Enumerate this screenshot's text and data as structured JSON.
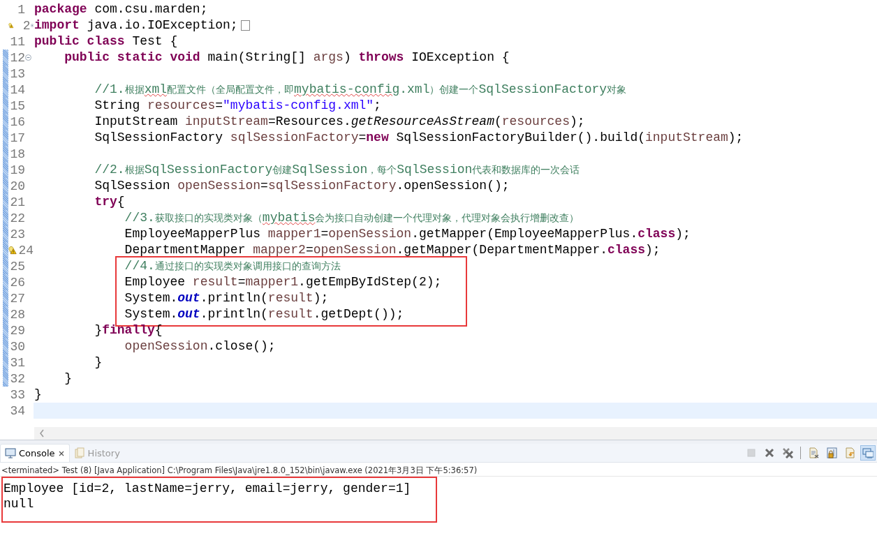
{
  "editor": {
    "lines": [
      {
        "number": "1",
        "tokens": [
          {
            "kind": "kw",
            "t": "package "
          },
          {
            "kind": "txt",
            "t": "com.csu.marden;"
          }
        ]
      },
      {
        "number": "2",
        "warning": true,
        "expanded": false,
        "folded": true,
        "tokens": [
          {
            "kind": "kw",
            "t": "import "
          },
          {
            "kind": "txt",
            "t": "java.io.IOException;"
          }
        ]
      },
      {
        "number": "11",
        "tokens": [
          {
            "kind": "kw",
            "t": "public class "
          },
          {
            "kind": "txt",
            "t": "Test {"
          }
        ]
      },
      {
        "number": "12",
        "changed": true,
        "expanded": true,
        "tokens": [
          {
            "kind": "kw",
            "t": "    public static void "
          },
          {
            "kind": "txt",
            "t": "main(String[] "
          },
          {
            "kind": "var",
            "t": "args"
          },
          {
            "kind": "txt",
            "t": ") "
          },
          {
            "kind": "kw",
            "t": "throws "
          },
          {
            "kind": "txt",
            "t": "IOException {"
          }
        ]
      },
      {
        "number": "13",
        "changed": true
      },
      {
        "number": "14",
        "changed": true,
        "tokens": [
          {
            "kind": "cmt",
            "t": "        //1."
          },
          {
            "kind": "cjk",
            "t": "根据"
          },
          {
            "kind": "err",
            "t": "xml"
          },
          {
            "kind": "cjk",
            "t": "配置文件（全局配置文件，即"
          },
          {
            "kind": "err",
            "t": "mybatis-config"
          },
          {
            "kind": "cmt",
            "t": ".xml"
          },
          {
            "kind": "cjk",
            "t": "）创建一个"
          },
          {
            "kind": "cmt",
            "t": "SqlSessionFactory"
          },
          {
            "kind": "cjk",
            "t": "对象"
          }
        ]
      },
      {
        "number": "15",
        "changed": true,
        "tokens": [
          {
            "kind": "txt",
            "t": "        String "
          },
          {
            "kind": "var",
            "t": "resources"
          },
          {
            "kind": "txt",
            "t": "="
          },
          {
            "kind": "str",
            "t": "\"mybatis-config.xml\""
          },
          {
            "kind": "txt",
            "t": ";"
          }
        ]
      },
      {
        "number": "16",
        "changed": true,
        "tokens": [
          {
            "kind": "txt",
            "t": "        InputStream "
          },
          {
            "kind": "var",
            "t": "inputStream"
          },
          {
            "kind": "txt",
            "t": "=Resources."
          },
          {
            "kind": "ital",
            "t": "getResourceAsStream"
          },
          {
            "kind": "txt",
            "t": "("
          },
          {
            "kind": "var",
            "t": "resources"
          },
          {
            "kind": "txt",
            "t": ");"
          }
        ]
      },
      {
        "number": "17",
        "changed": true,
        "tokens": [
          {
            "kind": "txt",
            "t": "        SqlSessionFactory "
          },
          {
            "kind": "var",
            "t": "sqlSessionFactory"
          },
          {
            "kind": "txt",
            "t": "="
          },
          {
            "kind": "kw",
            "t": "new"
          },
          {
            "kind": "txt",
            "t": " SqlSessionFactoryBuilder().build("
          },
          {
            "kind": "var",
            "t": "inputStream"
          },
          {
            "kind": "txt",
            "t": ");"
          }
        ]
      },
      {
        "number": "18",
        "changed": true
      },
      {
        "number": "19",
        "changed": true,
        "tokens": [
          {
            "kind": "cmt",
            "t": "        //2."
          },
          {
            "kind": "cjk",
            "t": "根据"
          },
          {
            "kind": "cmt",
            "t": "SqlSessionFactory"
          },
          {
            "kind": "cjk",
            "t": "创建"
          },
          {
            "kind": "cmt",
            "t": "SqlSession"
          },
          {
            "kind": "cjk",
            "t": "，每个"
          },
          {
            "kind": "cmt",
            "t": "SqlSession"
          },
          {
            "kind": "cjk",
            "t": "代表和数据库的一次会话"
          }
        ]
      },
      {
        "number": "20",
        "changed": true,
        "tokens": [
          {
            "kind": "txt",
            "t": "        SqlSession "
          },
          {
            "kind": "var",
            "t": "openSession"
          },
          {
            "kind": "txt",
            "t": "="
          },
          {
            "kind": "var",
            "t": "sqlSessionFactory"
          },
          {
            "kind": "txt",
            "t": ".openSession();"
          }
        ]
      },
      {
        "number": "21",
        "changed": true,
        "tokens": [
          {
            "kind": "kw",
            "t": "        try"
          },
          {
            "kind": "txt",
            "t": "{"
          }
        ]
      },
      {
        "number": "22",
        "changed": true,
        "tokens": [
          {
            "kind": "cmt",
            "t": "            //3."
          },
          {
            "kind": "cjk",
            "t": "获取接口的实现类对象（"
          },
          {
            "kind": "err",
            "t": "mybatis"
          },
          {
            "kind": "cjk",
            "t": "会为接口自动创建一个代理对象，代理对象会执行增删改查）"
          }
        ]
      },
      {
        "number": "23",
        "changed": true,
        "tokens": [
          {
            "kind": "txt",
            "t": "            EmployeeMapperPlus "
          },
          {
            "kind": "var",
            "t": "mapper1"
          },
          {
            "kind": "txt",
            "t": "="
          },
          {
            "kind": "var",
            "t": "openSession"
          },
          {
            "kind": "txt",
            "t": ".getMapper(EmployeeMapperPlus."
          },
          {
            "kind": "kw",
            "t": "class"
          },
          {
            "kind": "txt",
            "t": ");"
          }
        ]
      },
      {
        "number": "24",
        "changed": true,
        "warning": true,
        "tokens": [
          {
            "kind": "txt",
            "t": "            DepartmentMapper "
          },
          {
            "kind": "var",
            "t": "mapper2"
          },
          {
            "kind": "txt",
            "t": "="
          },
          {
            "kind": "var",
            "t": "openSession"
          },
          {
            "kind": "txt",
            "t": ".getMapper(DepartmentMapper."
          },
          {
            "kind": "kw",
            "t": "class"
          },
          {
            "kind": "txt",
            "t": ");"
          }
        ]
      },
      {
        "number": "25",
        "changed": true,
        "boxed": true,
        "tokens": [
          {
            "kind": "cmt",
            "t": "            //4."
          },
          {
            "kind": "cjk",
            "t": "通过接口的实现类对象调用接口的查询方法"
          }
        ]
      },
      {
        "number": "26",
        "changed": true,
        "boxed": true,
        "tokens": [
          {
            "kind": "txt",
            "t": "            Employee "
          },
          {
            "kind": "var",
            "t": "result"
          },
          {
            "kind": "txt",
            "t": "="
          },
          {
            "kind": "var",
            "t": "mapper1"
          },
          {
            "kind": "txt",
            "t": ".getEmpByIdStep(2);"
          }
        ]
      },
      {
        "number": "27",
        "changed": true,
        "boxed": true,
        "tokens": [
          {
            "kind": "txt",
            "t": "            System."
          },
          {
            "kind": "field",
            "t": "out"
          },
          {
            "kind": "txt",
            "t": ".println("
          },
          {
            "kind": "var",
            "t": "result"
          },
          {
            "kind": "txt",
            "t": ");"
          }
        ]
      },
      {
        "number": "28",
        "changed": true,
        "boxed": true,
        "tokens": [
          {
            "kind": "txt",
            "t": "            System."
          },
          {
            "kind": "field",
            "t": "out"
          },
          {
            "kind": "txt",
            "t": ".println("
          },
          {
            "kind": "var",
            "t": "result"
          },
          {
            "kind": "txt",
            "t": ".getDept());"
          }
        ]
      },
      {
        "number": "29",
        "changed": true,
        "tokens": [
          {
            "kind": "txt",
            "t": "        }"
          },
          {
            "kind": "kw",
            "t": "finally"
          },
          {
            "kind": "txt",
            "t": "{"
          }
        ]
      },
      {
        "number": "30",
        "changed": true,
        "tokens": [
          {
            "kind": "var",
            "t": "            openSession"
          },
          {
            "kind": "txt",
            "t": ".close();"
          }
        ]
      },
      {
        "number": "31",
        "changed": true,
        "tokens": [
          {
            "kind": "txt",
            "t": "        }"
          }
        ]
      },
      {
        "number": "32",
        "changed": true,
        "tokens": [
          {
            "kind": "txt",
            "t": "    }"
          }
        ]
      },
      {
        "number": "33",
        "tokens": [
          {
            "kind": "txt",
            "t": "}"
          }
        ]
      },
      {
        "number": "34",
        "current": true
      }
    ]
  },
  "console": {
    "tabs": [
      {
        "label": "Console",
        "kind": "console",
        "selected": true,
        "closable": true
      },
      {
        "label": "History",
        "kind": "history",
        "selected": false,
        "closable": false
      }
    ],
    "toolbar": [
      {
        "kind": "stop",
        "disabled": true,
        "selected": false
      },
      {
        "kind": "remove",
        "disabled": false,
        "selected": false
      },
      {
        "kind": "remove-all",
        "disabled": false,
        "selected": false
      },
      {
        "kind": "separator"
      },
      {
        "kind": "clear",
        "disabled": false,
        "selected": false
      },
      {
        "kind": "scroll-lock",
        "disabled": false,
        "selected": false
      },
      {
        "kind": "pin",
        "disabled": false,
        "selected": false
      },
      {
        "kind": "display",
        "disabled": false,
        "selected": true
      }
    ],
    "process": "<terminated> Test (8) [Java Application] C:\\Program Files\\Java\\jre1.8.0_152\\bin\\javaw.exe (2021年3月3日 下午5:36:57)",
    "boxed": true,
    "output": [
      "Employee [id=2, lastName=jerry, email=jerry, gender=1]",
      "null"
    ]
  }
}
